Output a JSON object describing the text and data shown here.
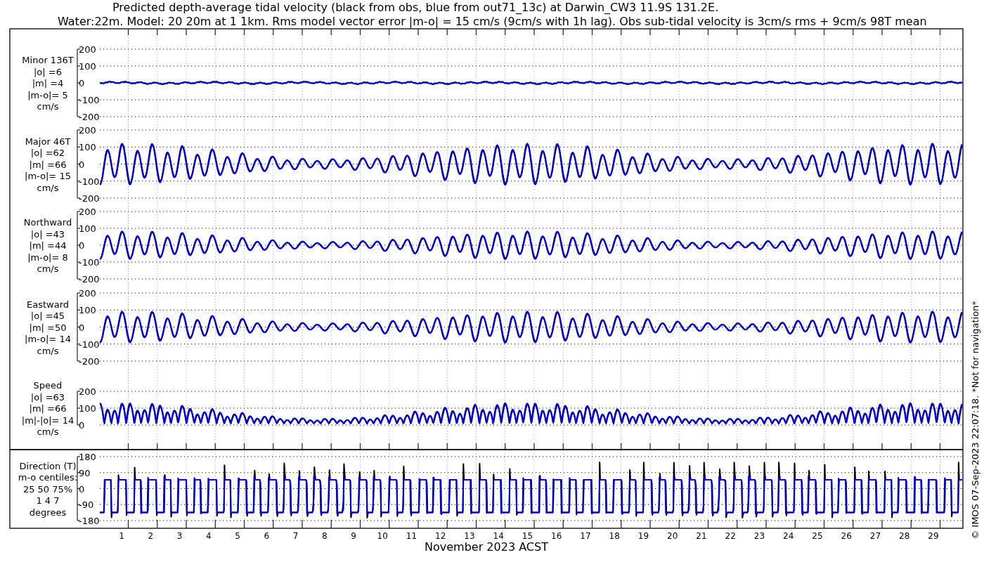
{
  "title_lines": [
    "Predicted depth-average tidal velocity (black from obs, blue from out71_13c) at Darwin_CW3 11.9S 131.2E.",
    "Water:22m. Model: 20 20m at 1 1km. Rms model vector error |m-o| = 15 cm/s (9cm/s with 1h lag). Obs sub-tidal velocity is 3cm/s rms + 9cm/s 98T mean"
  ],
  "panels": [
    {
      "kind": "minor",
      "label_lines": [
        "Minor 136T",
        "|o| =6",
        "|m| =4",
        "|m-o|= 5",
        "cm/s"
      ],
      "yticks": [
        "200",
        "100",
        "0",
        "-100",
        "-200"
      ]
    },
    {
      "kind": "major",
      "label_lines": [
        "Major 46T",
        "|o| =62",
        "|m| =66",
        "|m-o|= 15",
        "cm/s"
      ],
      "yticks": [
        "200",
        "100",
        "0",
        "-100",
        "-200"
      ]
    },
    {
      "kind": "northward",
      "label_lines": [
        "Northward",
        "|o| =43",
        "|m| =44",
        "|m-o|= 8",
        "cm/s"
      ],
      "yticks": [
        "200",
        "100",
        "0",
        "-100",
        "-200"
      ]
    },
    {
      "kind": "eastward",
      "label_lines": [
        "Eastward",
        "|o| =45",
        "|m| =50",
        "|m-o|= 14",
        "cm/s"
      ],
      "yticks": [
        "200",
        "100",
        "0",
        "-100",
        "-200"
      ]
    },
    {
      "kind": "speed",
      "label_lines": [
        "Speed",
        "|o| =63",
        "|m| =66",
        "|m|-|o|= 14",
        "cm/s"
      ],
      "yticks": [
        "200",
        "100",
        "0"
      ]
    },
    {
      "kind": "direction",
      "label_lines": [
        "Direction (T)",
        "m-o centiles:",
        "25  50  75%",
        "1  4  7",
        "degrees"
      ],
      "yticks": [
        "180",
        "90",
        "0",
        "-90",
        "-180"
      ]
    }
  ],
  "day_labels": [
    "1",
    "2",
    "3",
    "4",
    "5",
    "6",
    "7",
    "8",
    "9",
    "10",
    "11",
    "12",
    "13",
    "14",
    "15",
    "16",
    "17",
    "18",
    "19",
    "20",
    "21",
    "22",
    "23",
    "24",
    "25",
    "26",
    "27",
    "28",
    "29"
  ],
  "xlabel": "November 2023 ACST",
  "side_note": "© IMOS 07-Sep-2023 22:07:18. *Not for navigation*"
}
